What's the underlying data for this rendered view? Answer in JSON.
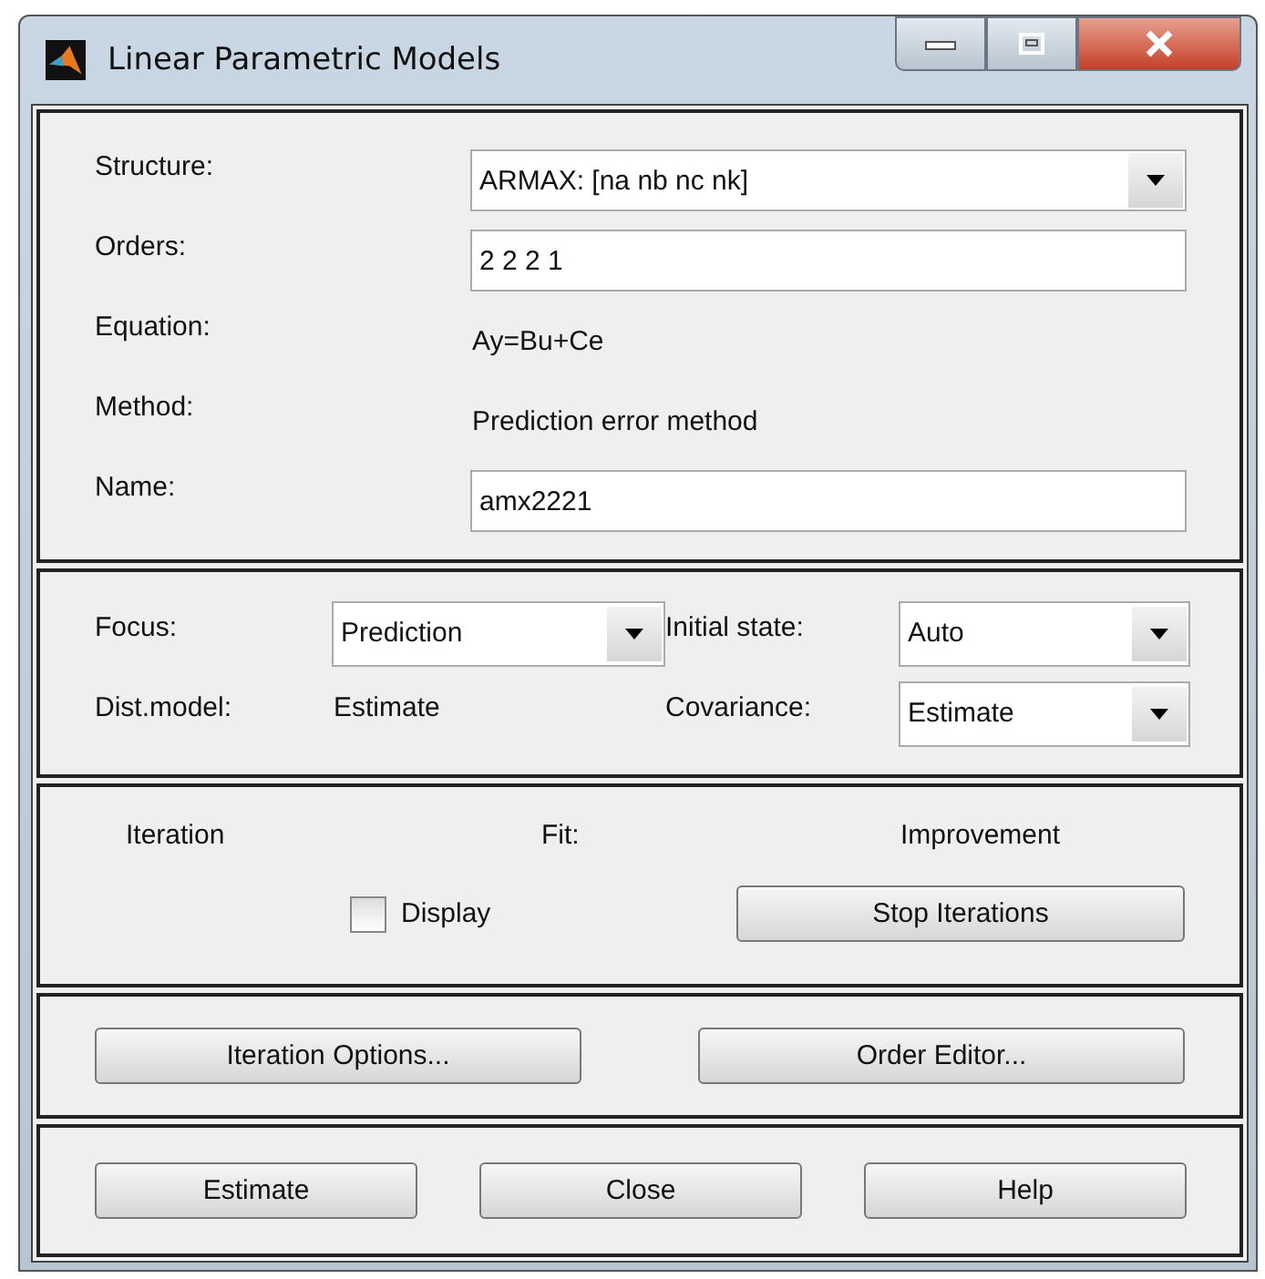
{
  "window": {
    "title": "Linear Parametric Models"
  },
  "model": [
    {
      "kind": "dropdown",
      "label": "Structure:",
      "value": "ARMAX: [na nb nc nk]"
    },
    {
      "kind": "field",
      "label": "Orders:",
      "value": "2 2 2 1"
    },
    {
      "kind": "text",
      "label": "Equation:",
      "value": "Ay=Bu+Ce"
    },
    {
      "kind": "text",
      "label": "Method:",
      "value": "Prediction error method"
    },
    {
      "kind": "field",
      "label": "Name:",
      "value": "amx2221"
    }
  ],
  "options": [
    {
      "kind": "dropdown",
      "label": "Focus:",
      "value": "Prediction"
    },
    {
      "kind": "dropdown",
      "label": "Initial state:",
      "value": "Auto"
    },
    {
      "kind": "text",
      "label": "Dist.model:",
      "value": "Estimate"
    },
    {
      "kind": "dropdown",
      "label": "Covariance:",
      "value": "Estimate"
    }
  ],
  "iteration": {
    "headings": [
      "Iteration",
      "Fit:",
      "Improvement"
    ],
    "display": {
      "label": "Display",
      "checked": false
    },
    "stop_button": "Stop Iterations"
  },
  "tool_buttons": [
    "Iteration Options...",
    "Order Editor..."
  ],
  "buttons": [
    "Estimate",
    "Close",
    "Help"
  ]
}
